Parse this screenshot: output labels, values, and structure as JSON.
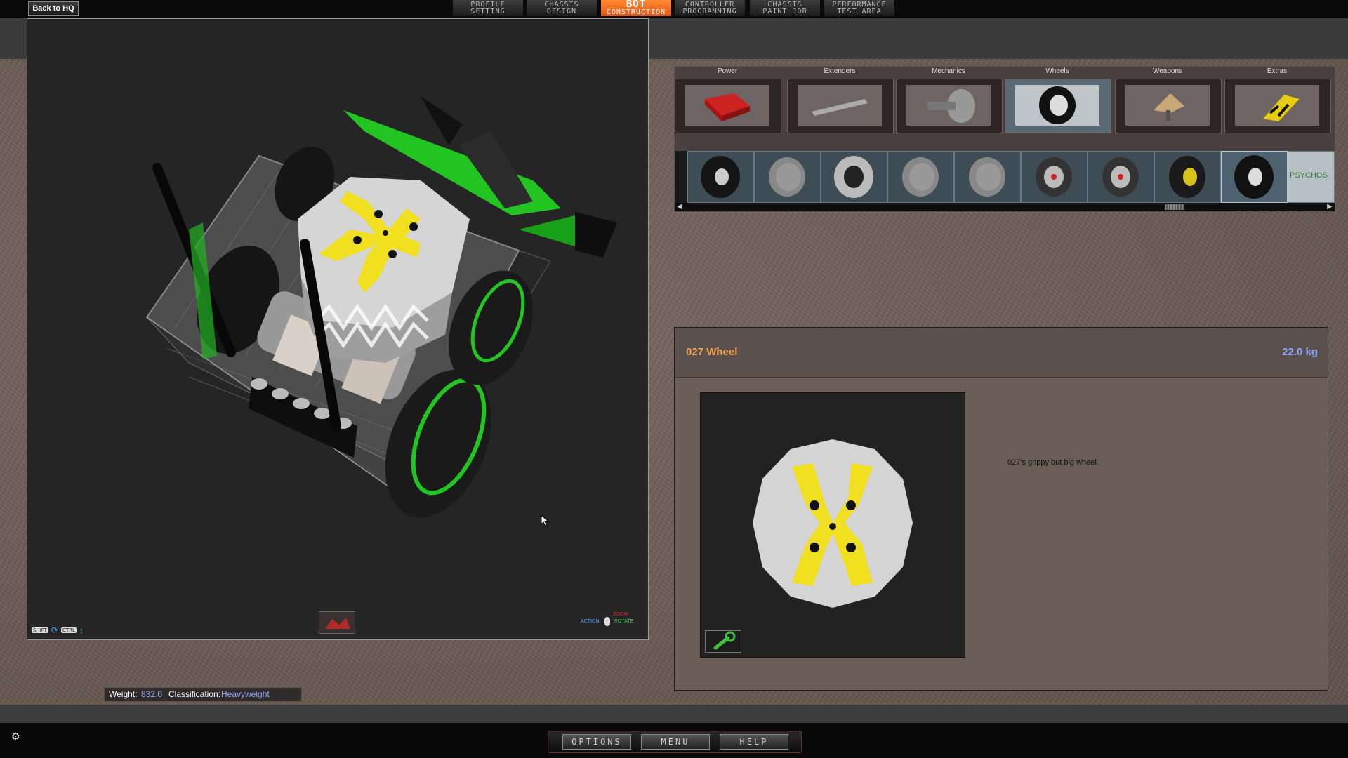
{
  "topbar": {
    "back_label": "Back to HQ",
    "tabs": [
      {
        "l1": "PROFILE",
        "l2": "SETTING"
      },
      {
        "l1": "CHASSIS",
        "l2": "DESIGN"
      },
      {
        "l1": "BOT",
        "l2": "CONSTRUCTION"
      },
      {
        "l1": "CONTROLLER",
        "l2": "PROGRAMMING"
      },
      {
        "l1": "CHASSIS",
        "l2": "PAINT JOB"
      },
      {
        "l1": "PERFORMANCE",
        "l2": "TEST AREA"
      }
    ],
    "active_tab": "BOT CONSTRUCTION"
  },
  "viewport": {
    "hint_left": {
      "shift": "SHIFT",
      "ctrl": "CTRL"
    },
    "hint_right": {
      "zoom": "ZOOM",
      "action": "ACTION",
      "rotate": "ROTATE"
    }
  },
  "parts": {
    "categories": [
      "Power",
      "Extenders",
      "Mechanics",
      "Wheels",
      "Weapons",
      "Extras"
    ],
    "active_category": "Wheels",
    "wheel_strip_label": "PSYCHOS"
  },
  "info": {
    "part_name": "027 Wheel",
    "part_weight": "22.0 kg",
    "description": "027's grippy but big wheel."
  },
  "status": {
    "weight_label": "Weight:",
    "weight_value": "832.0",
    "class_label": "Classification:",
    "class_value": "Heavyweight"
  },
  "bottom_menu": [
    "OPTIONS",
    "MENU",
    "HELP"
  ],
  "colors": {
    "accent_orange": "#f4a356",
    "active_tab": "#ff8a30",
    "weight_blue": "#8fa6ff",
    "robot_green": "#22c422",
    "wheel_yellow": "#f0e020"
  },
  "icons": {
    "tool": "wrench-icon",
    "corner": "options-gear-icon",
    "cursor": "mouse-cursor-icon"
  }
}
